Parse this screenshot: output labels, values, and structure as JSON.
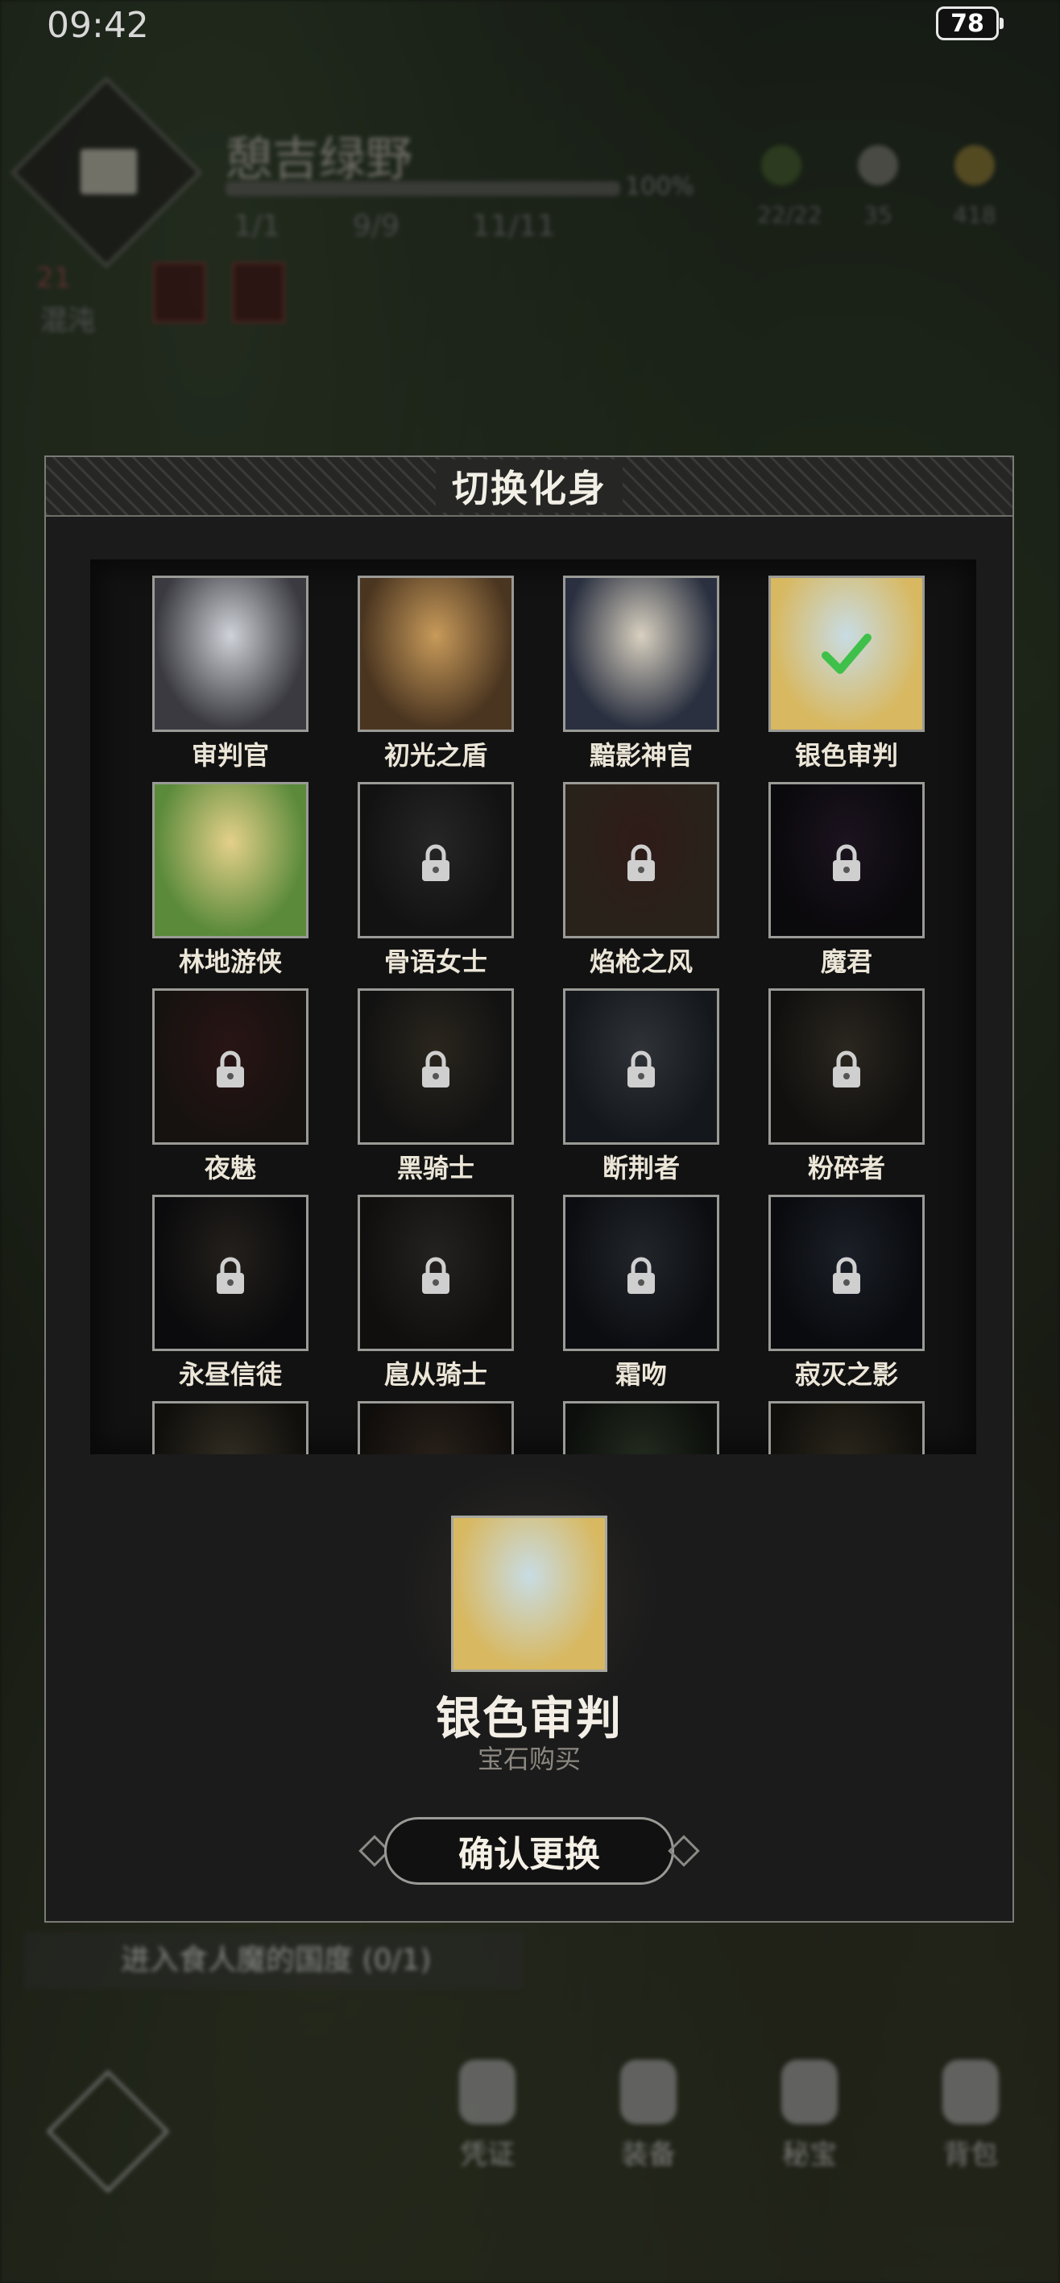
{
  "status_bar": {
    "time": "09:42",
    "battery": "78"
  },
  "hud": {
    "area_name": "憩吉绿野",
    "progress": "100%",
    "stats": [
      "1/1",
      "9/9",
      "11/11"
    ],
    "resources": [
      "22/22",
      "35",
      "418"
    ],
    "level": "21",
    "level_label": "混沌"
  },
  "dialog": {
    "title": "切换化身",
    "avatars": [
      {
        "name": "审判官",
        "locked": false,
        "selected": false,
        "colors": [
          "#cfd2d8",
          "#3a3a40"
        ]
      },
      {
        "name": "初光之盾",
        "locked": false,
        "selected": false,
        "colors": [
          "#c89a5a",
          "#4a3520"
        ]
      },
      {
        "name": "黯影神官",
        "locked": false,
        "selected": false,
        "colors": [
          "#d8d0c0",
          "#2a3040"
        ]
      },
      {
        "name": "银色审判",
        "locked": false,
        "selected": true,
        "colors": [
          "#c8dce4",
          "#d8b860"
        ]
      },
      {
        "name": "林地游侠",
        "locked": false,
        "selected": false,
        "colors": [
          "#e4d08a",
          "#5a8a3a"
        ]
      },
      {
        "name": "骨语女士",
        "locked": true,
        "selected": false,
        "colors": [
          "#5a5a5a",
          "#2a2a2a"
        ]
      },
      {
        "name": "焰枪之风",
        "locked": true,
        "selected": false,
        "colors": [
          "#8a3a30",
          "#6a5030"
        ]
      },
      {
        "name": "魔君",
        "locked": true,
        "selected": false,
        "colors": [
          "#4a2a5a",
          "#1a1420"
        ]
      },
      {
        "name": "夜魅",
        "locked": true,
        "selected": false,
        "colors": [
          "#7a2a2a",
          "#3a2a20"
        ]
      },
      {
        "name": "黑骑士",
        "locked": true,
        "selected": false,
        "colors": [
          "#6a5a3a",
          "#2a2a2a"
        ]
      },
      {
        "name": "断荆者",
        "locked": true,
        "selected": false,
        "colors": [
          "#6a7a8a",
          "#2a3a4a"
        ]
      },
      {
        "name": "粉碎者",
        "locked": true,
        "selected": false,
        "colors": [
          "#6a5a40",
          "#2a2620"
        ]
      },
      {
        "name": "永昼信徒",
        "locked": true,
        "selected": false,
        "colors": [
          "#5a4a3a",
          "#1a1a20"
        ]
      },
      {
        "name": "扈从骑士",
        "locked": true,
        "selected": false,
        "colors": [
          "#5a5048",
          "#2a2420"
        ]
      },
      {
        "name": "霜吻",
        "locked": true,
        "selected": false,
        "colors": [
          "#4a5a6a",
          "#1a2030"
        ]
      },
      {
        "name": "寂灭之影",
        "locked": true,
        "selected": false,
        "colors": [
          "#3a4a6a",
          "#141a28"
        ]
      },
      {
        "name": "",
        "locked": true,
        "selected": false,
        "colors": [
          "#7a6a40",
          "#2a2418"
        ]
      },
      {
        "name": "",
        "locked": true,
        "selected": false,
        "colors": [
          "#6a4a30",
          "#2a2018"
        ]
      },
      {
        "name": "",
        "locked": true,
        "selected": false,
        "colors": [
          "#4a6a3a",
          "#1a2418"
        ]
      },
      {
        "name": "",
        "locked": true,
        "selected": false,
        "colors": [
          "#6a5a30",
          "#2a2418"
        ]
      }
    ],
    "selected": {
      "name": "银色审判",
      "source": "宝石购买",
      "colors": [
        "#c8dce4",
        "#d8b860"
      ]
    },
    "confirm_label": "确认更换"
  },
  "bottom": {
    "quest": "进入食人魔的国度 (0/1)",
    "nav": [
      "凭证",
      "装备",
      "秘宝",
      "背包"
    ]
  }
}
